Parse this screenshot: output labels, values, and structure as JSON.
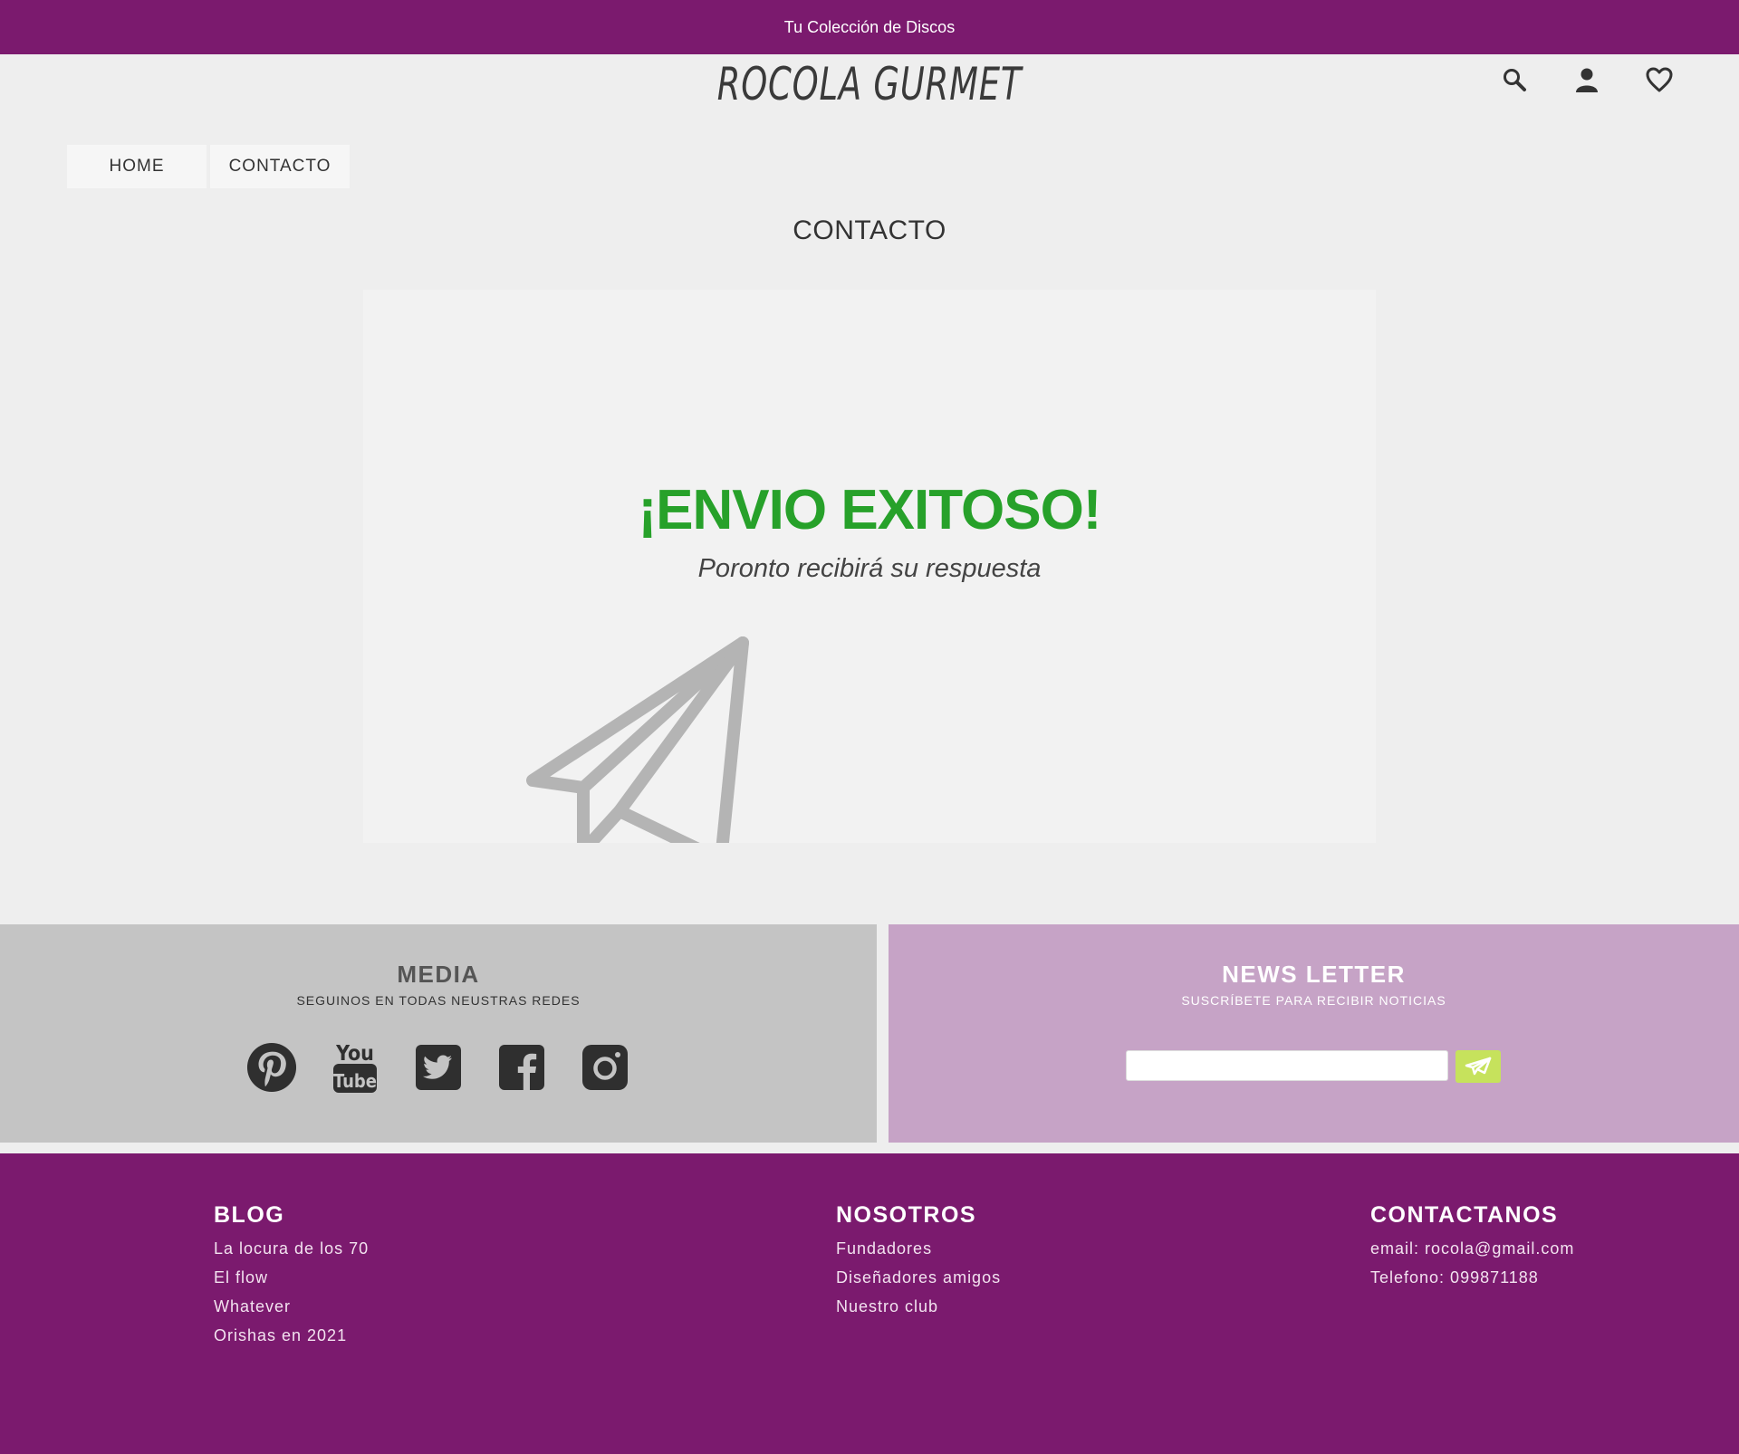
{
  "topbar": {
    "text": "Tu Colección de Discos"
  },
  "header": {
    "logo": "ROCOLA GURMET",
    "icons": [
      "search-icon",
      "user-icon",
      "heart-icon"
    ]
  },
  "breadcrumb": {
    "items": [
      "HOME",
      "CONTACTO"
    ]
  },
  "page": {
    "title": "CONTACTO"
  },
  "success": {
    "title": "¡ENVIO EXITOSO!",
    "subtitle": "Poronto recibirá su respuesta",
    "icon": "paper-plane-icon"
  },
  "media": {
    "title": "MEDIA",
    "subtitle": "SEGUINOS EN TODAS NEUSTRAS REDES",
    "networks": [
      "pinterest-icon",
      "youtube-icon",
      "twitter-icon",
      "facebook-icon",
      "instagram-icon"
    ],
    "youtube_top": "You",
    "youtube_bottom": "Tube"
  },
  "newsletter": {
    "title": "NEWS LETTER",
    "subtitle": "SUSCRÍBETE PARA RECIBIR NOTICIAS",
    "input_value": "",
    "button_icon": "send-icon"
  },
  "footer": {
    "blog": {
      "title": "BLOG",
      "links": [
        "La locura de los 70",
        "El flow",
        "Whatever",
        "Orishas en 2021"
      ]
    },
    "nosotros": {
      "title": "NOSOTROS",
      "links": [
        "Fundadores",
        "Diseñadores amigos",
        "Nuestro club"
      ]
    },
    "contacto": {
      "title": "CONTACTANOS",
      "links": [
        "email: rocola@gmail.com",
        "Telefono: 099871188"
      ]
    }
  },
  "colors": {
    "brand_purple": "#7b1a6e",
    "success_green": "#27a12a",
    "media_bg": "#c4c4c4",
    "newsletter_bg": "#c6a3c6",
    "send_button": "#c6e25c"
  }
}
